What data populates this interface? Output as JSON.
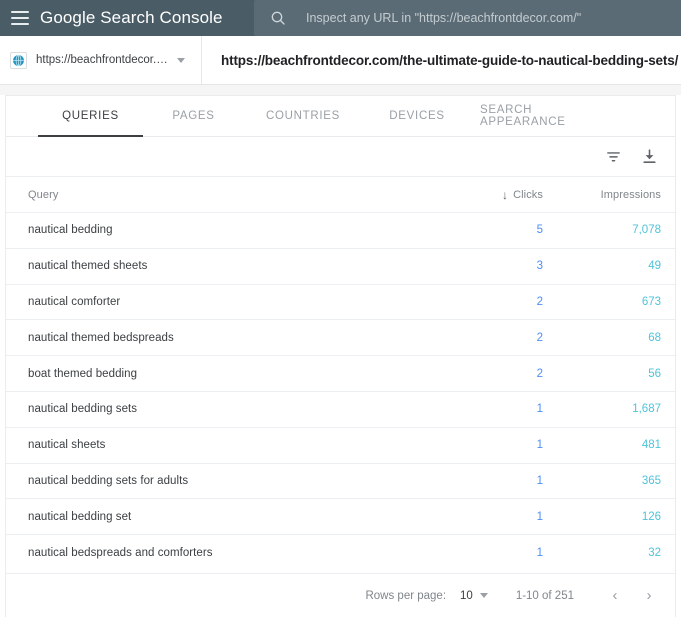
{
  "appbar": {
    "menu_icon": "hamburger-menu-icon",
    "brand_bold": "Google",
    "brand_light": " Search Console",
    "search_icon": "search-icon",
    "search_placeholder": "Inspect any URL in \"https://beachfrontdecor.com/\"",
    "background": "#4a5c66",
    "search_background": "#5b6b75"
  },
  "urlbar": {
    "property_icon": "globe-icon",
    "property_url": "https://beachfrontdecor.com/",
    "dropdown_icon": "chevron-down-icon",
    "inspected_url": "https://beachfrontdecor.com/the-ultimate-guide-to-nautical-bedding-sets/"
  },
  "tabs": [
    {
      "label": "QUERIES",
      "active": true
    },
    {
      "label": "PAGES",
      "active": false
    },
    {
      "label": "COUNTRIES",
      "active": false
    },
    {
      "label": "DEVICES",
      "active": false
    },
    {
      "label": "SEARCH APPEARANCE",
      "active": false
    }
  ],
  "toolbar": {
    "filter_icon": "filter-icon",
    "download_icon": "download-icon"
  },
  "table": {
    "columns": {
      "query": "Query",
      "clicks": "Clicks",
      "impressions": "Impressions"
    },
    "sort": {
      "column": "Clicks",
      "direction": "descending",
      "indicator": "↓"
    },
    "rows": [
      {
        "query": "nautical bedding",
        "clicks": "5",
        "impressions": "7,078"
      },
      {
        "query": "nautical themed sheets",
        "clicks": "3",
        "impressions": "49"
      },
      {
        "query": "nautical comforter",
        "clicks": "2",
        "impressions": "673"
      },
      {
        "query": "nautical themed bedspreads",
        "clicks": "2",
        "impressions": "68"
      },
      {
        "query": "boat themed bedding",
        "clicks": "2",
        "impressions": "56"
      },
      {
        "query": "nautical bedding sets",
        "clicks": "1",
        "impressions": "1,687"
      },
      {
        "query": "nautical sheets",
        "clicks": "1",
        "impressions": "481"
      },
      {
        "query": "nautical bedding sets for adults",
        "clicks": "1",
        "impressions": "365"
      },
      {
        "query": "nautical bedding set",
        "clicks": "1",
        "impressions": "126"
      },
      {
        "query": "nautical bedspreads and comforters",
        "clicks": "1",
        "impressions": "32"
      }
    ]
  },
  "footer": {
    "rows_per_page_label": "Rows per page:",
    "rows_per_page_value": "10",
    "rows_per_page_caret": "chevron-down-icon",
    "range": "1-10 of 251",
    "prev_icon": "chevron-left-icon",
    "next_icon": "chevron-right-icon",
    "prev_glyph": "‹",
    "next_glyph": "›"
  },
  "colors": {
    "clicks_link": "#4e8df5",
    "impressions_link": "#4fc3d9",
    "appbar": "#4a5c66"
  }
}
